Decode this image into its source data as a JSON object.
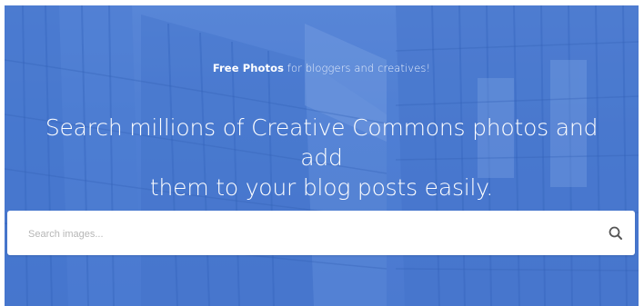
{
  "hero": {
    "tagline_bold": "Free Photos",
    "tagline_rest": " for bloggers and creatives!",
    "headline_line1": "Search millions of Creative Commons photos and add",
    "headline_line2": "them to your blog posts easily."
  },
  "search": {
    "placeholder": "Search images...",
    "value": "",
    "button_icon": "search-icon"
  },
  "colors": {
    "hero_blue": "#4f7fd4",
    "search_bg": "#ffffff",
    "icon_gray": "#555555"
  }
}
